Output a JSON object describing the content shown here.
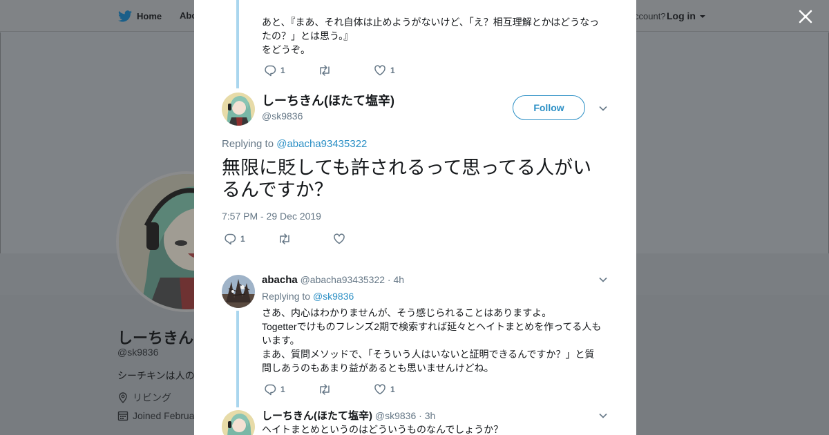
{
  "background": {
    "nav": {
      "home": "Home",
      "about": "Abo"
    },
    "account_text": "ccount?",
    "login": "Log in",
    "profile": {
      "name": "しーちきん(",
      "handle": "@sk9836",
      "bio": "シーチキンは人の",
      "location": "リビング",
      "joined": "Joined Februa"
    }
  },
  "tweets": {
    "previous": {
      "line1": "あと、『まあ、それ自体は止めようがないけど、「え？相互理解とかはどうなっ",
      "line2": "たの？」とは思う。』",
      "line3": "をどうぞ。",
      "reply_count": "1",
      "like_count": "1"
    },
    "main": {
      "name": "しーちきん(ほたて塩辛)",
      "handle": "@sk9836",
      "follow_label": "Follow",
      "replying_prefix": "Replying to",
      "replying_to": "@abacha93435322",
      "text_line1": "無限に貶しても許されるって思ってる人がい",
      "text_line2": "るんですか？",
      "timestamp": "7:57 PM - 29 Dec 2019",
      "reply_count": "1"
    },
    "reply1": {
      "name": "abacha",
      "handle": "@abacha93435322",
      "time": "4h",
      "replying_prefix": "Replying to",
      "replying_to": "@sk9836",
      "line1": "さあ、内心はわかりませんが、そう感じられることはありますよ。",
      "line2": "Togetterでけものフレンズ2期で検索すれば延々とヘイトまとめを作ってる人も",
      "line3": "います。",
      "line4": "まあ、質問メソッドで、「そういう人はいないと証明できるんですか？」と質",
      "line5": "問しあうのもあまり益があるとも思いませんけどね。",
      "reply_count": "1",
      "like_count": "1"
    },
    "reply2": {
      "name": "しーちきん(ほたて塩辛)",
      "handle": "@sk9836",
      "time": "3h",
      "line1": "ヘイトまとめというのはどういうものなんでしょうか？"
    }
  },
  "separator": "·",
  "colors": {
    "link": "#2b8fc5",
    "thread": "#aad6ee",
    "muted": "#657786"
  },
  "icons": [
    "twitter-bird-icon",
    "close-icon",
    "reply-icon",
    "retweet-icon",
    "like-icon",
    "chevron-down-icon",
    "location-icon",
    "calendar-icon"
  ]
}
